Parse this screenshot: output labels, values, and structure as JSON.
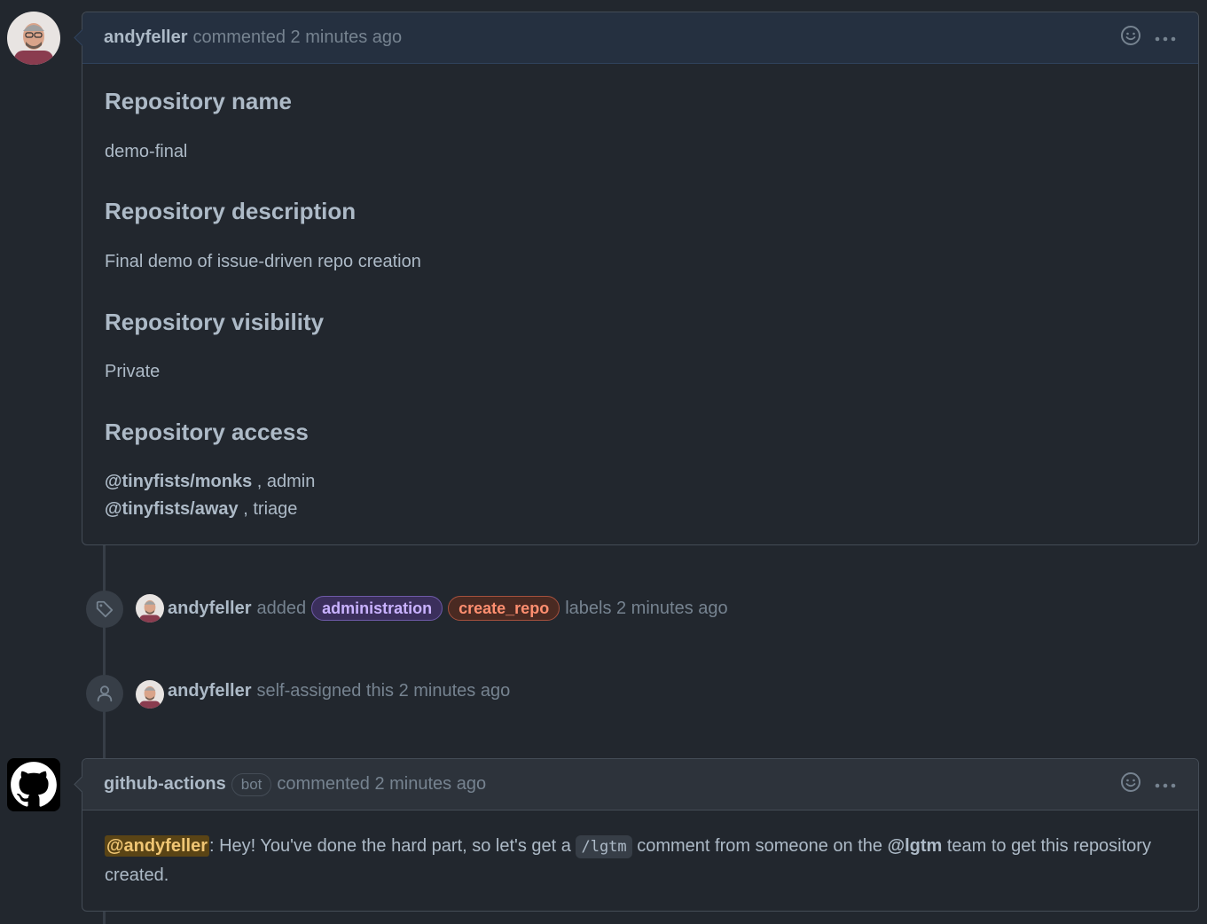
{
  "first_comment": {
    "author": "andyfeller",
    "action": "commented 2 minutes ago",
    "sections": [
      {
        "heading": "Repository name",
        "content": "demo-final"
      },
      {
        "heading": "Repository description",
        "content": "Final demo of issue-driven repo creation"
      },
      {
        "heading": "Repository visibility",
        "content": "Private"
      },
      {
        "heading": "Repository access"
      }
    ],
    "access": [
      {
        "team": "@tinyfists/monks",
        "role": ", admin"
      },
      {
        "team": "@tinyfists/away",
        "role": ", triage"
      }
    ]
  },
  "events": {
    "labels_event": {
      "actor": "andyfeller",
      "verb": "added",
      "labels": [
        {
          "name": "administration",
          "bg": "#3b2f5c",
          "border": "#6e5aa8",
          "color": "#c9b2ff"
        },
        {
          "name": "create_repo",
          "bg": "#4a2a22",
          "border": "#a5503d",
          "color": "#ff8f70"
        }
      ],
      "suffix": "labels 2 minutes ago",
      "icon": "tag-icon"
    },
    "assign_event": {
      "actor": "andyfeller",
      "text": "self-assigned this 2 minutes ago",
      "icon": "person-icon"
    }
  },
  "bot_comment": {
    "author": "github-actions",
    "badge": "bot",
    "action": "commented 2 minutes ago",
    "mention": "@andyfeller",
    "text_1": ": Hey! You've done the hard part, so let's get a",
    "code": "/lgtm",
    "text_2": "comment from someone on the",
    "team": "@lgtm",
    "text_3": "team to get this repository created."
  },
  "icons": {
    "emoji": "smiley-icon",
    "menu": "kebab-icon"
  },
  "colors": {
    "background": "#22272e",
    "own_header": "#253040",
    "border": "#444c56"
  }
}
